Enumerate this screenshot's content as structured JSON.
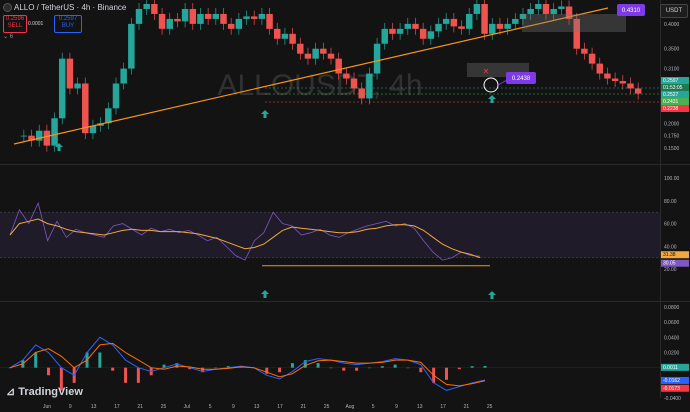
{
  "header": {
    "symbol_line": "ALLO / TetherUS · 4h · Binance",
    "sell_price": "0.2596",
    "sell_label": "SELL",
    "spread": "0.0001",
    "buy_price": "0.2597",
    "buy_label": "BUY",
    "indicator_count": "6"
  },
  "watermark": "ALLOUSDT, 4h",
  "currency": "USDT",
  "brand": "TradingView",
  "colors": {
    "bg": "#131313",
    "trendline": "#f7931a",
    "arrow": "#26a69a",
    "callout": "#7e3ae8",
    "rsi": "#7e57c2",
    "rsi_ma": "#f2a93b",
    "macd": "#2962ff",
    "signal": "#ff6d00"
  },
  "chart_data": [
    {
      "type": "candlestick",
      "pane": "price",
      "x_labels": [
        "Jun",
        "9",
        "13",
        "17",
        "21",
        "25",
        "Jul",
        "5",
        "9",
        "13",
        "17",
        "21",
        "25",
        "Aug",
        "5",
        "9",
        "13",
        "17",
        "21",
        "25"
      ],
      "ylim": [
        0.12,
        0.44
      ],
      "y_ticks": [
        "0.4000",
        "0.3500",
        "0.3100",
        "0.2700",
        "0.2300",
        "0.2000",
        "0.1750",
        "0.1500"
      ],
      "price_labels": [
        "0.2597",
        "01:53:05",
        "0.2527",
        "0.2431",
        "0.2238"
      ],
      "callouts": [
        "0.4310",
        "0.2438"
      ],
      "close_series": [
        0.175,
        0.165,
        0.185,
        0.155,
        0.21,
        0.33,
        0.27,
        0.28,
        0.18,
        0.195,
        0.2,
        0.23,
        0.28,
        0.31,
        0.4,
        0.43,
        0.44,
        0.42,
        0.39,
        0.41,
        0.405,
        0.43,
        0.4,
        0.42,
        0.41,
        0.42,
        0.4,
        0.39,
        0.41,
        0.415,
        0.41,
        0.42,
        0.39,
        0.37,
        0.38,
        0.36,
        0.34,
        0.33,
        0.35,
        0.34,
        0.33,
        0.3,
        0.29,
        0.27,
        0.25,
        0.3,
        0.36,
        0.39,
        0.38,
        0.39,
        0.4,
        0.39,
        0.37,
        0.385,
        0.4,
        0.41,
        0.395,
        0.39,
        0.42,
        0.44,
        0.38,
        0.4,
        0.39,
        0.4,
        0.41,
        0.42,
        0.43,
        0.44,
        0.42,
        0.43,
        0.435,
        0.41,
        0.35,
        0.34,
        0.32,
        0.3,
        0.29,
        0.285,
        0.28,
        0.27,
        0.2597
      ]
    },
    {
      "type": "line",
      "pane": "rsi",
      "ylim": [
        0,
        100
      ],
      "y_ticks": [
        "100.00",
        "80.00",
        "60.00",
        "40.00",
        "20.00"
      ],
      "value_labels": [
        "31.38",
        "30.05"
      ],
      "series": [
        {
          "values": [
            50,
            72,
            60,
            78,
            45,
            62,
            48,
            55,
            52,
            50,
            48,
            58,
            60,
            55,
            50,
            56,
            53,
            55,
            52,
            54,
            50,
            45,
            48,
            40,
            32,
            28,
            45,
            52,
            70,
            60,
            58,
            50,
            52,
            55,
            50,
            48,
            52,
            55,
            58,
            60,
            62,
            58,
            60,
            56,
            45,
            35,
            28,
            30,
            35,
            32,
            31.38
          ]
        },
        {
          "values": [
            50,
            60,
            62,
            64,
            60,
            58,
            55,
            53,
            52,
            51,
            50,
            52,
            54,
            55,
            54,
            54,
            53,
            53,
            53,
            52,
            51,
            49,
            47,
            44,
            41,
            38,
            39,
            42,
            48,
            54,
            57,
            56,
            55,
            54,
            53,
            52,
            52,
            53,
            55,
            56,
            58,
            59,
            59,
            58,
            54,
            48,
            42,
            38,
            35,
            33,
            30.05
          ]
        }
      ]
    },
    {
      "type": "line",
      "pane": "macd",
      "ylim": [
        -0.04,
        0.08
      ],
      "y_ticks": [
        "0.0800",
        "0.0600",
        "0.0400",
        "0.0200",
        "0.0011",
        "-0.0162",
        "-0.0173",
        "-0.0400"
      ],
      "series": [
        {
          "values": [
            0,
            0.01,
            0.03,
            0.02,
            0.0,
            -0.01,
            0.02,
            0.04,
            0.03,
            0.01,
            0.0,
            -0.005,
            0.0,
            0.005,
            0.0,
            -0.005,
            -0.002,
            0.0,
            0.002,
            0.0,
            -0.01,
            -0.015,
            -0.005,
            0.008,
            0.012,
            0.01,
            0.006,
            0.004,
            0.006,
            0.008,
            0.012,
            0.01,
            0.004,
            -0.02,
            -0.03,
            -0.025,
            -0.02,
            -0.0162
          ]
        },
        {
          "values": [
            0,
            0.005,
            0.02,
            0.025,
            0.015,
            0.0,
            0.01,
            0.03,
            0.032,
            0.02,
            0.01,
            0.0,
            -0.002,
            0.002,
            0.001,
            -0.002,
            -0.002,
            -0.001,
            0.001,
            0.0,
            -0.006,
            -0.012,
            -0.008,
            0.003,
            0.009,
            0.01,
            0.008,
            0.006,
            0.006,
            0.007,
            0.01,
            0.01,
            0.007,
            -0.01,
            -0.022,
            -0.024,
            -0.021,
            -0.0173
          ]
        }
      ]
    }
  ]
}
